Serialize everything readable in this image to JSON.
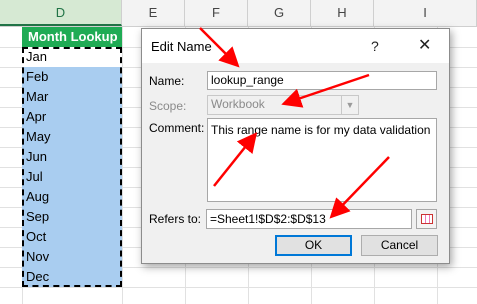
{
  "sheet": {
    "columns": [
      "D",
      "E",
      "F",
      "G",
      "H",
      "I"
    ],
    "header_cell": "Month Lookup",
    "months": [
      "Jan",
      "Feb",
      "Mar",
      "Apr",
      "May",
      "Jun",
      "Jul",
      "Aug",
      "Sep",
      "Oct",
      "Nov",
      "Dec"
    ]
  },
  "dialog": {
    "title": "Edit Name",
    "help": "?",
    "close": "✕",
    "name_label": "Name:",
    "name_value": "lookup_range",
    "scope_label": "Scope:",
    "scope_value": "Workbook",
    "comment_label": "Comment:",
    "comment_value": "This range name is for my data validation",
    "refers_label": "Refers to:",
    "refers_value": "=Sheet1!$D$2:$D$13",
    "ok_label": "OK",
    "cancel_label": "Cancel"
  },
  "colors": {
    "header_green": "#1fab54",
    "selection_blue": "#a9cdf0",
    "arrow_red": "#ff0000"
  }
}
